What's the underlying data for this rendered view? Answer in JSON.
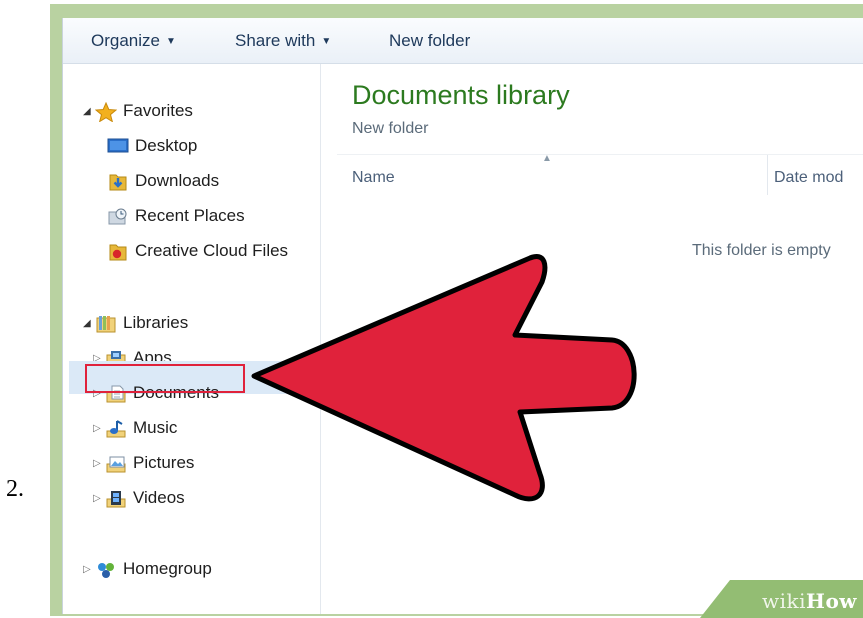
{
  "step": {
    "number": "2."
  },
  "toolbar": {
    "organize": "Organize",
    "share_with": "Share with",
    "new_folder": "New folder"
  },
  "nav": {
    "favorites": {
      "label": "Favorites",
      "items": [
        {
          "label": "Desktop",
          "icon": "desktop-icon"
        },
        {
          "label": "Downloads",
          "icon": "downloads-icon"
        },
        {
          "label": "Recent Places",
          "icon": "recent-places-icon"
        },
        {
          "label": "Creative Cloud Files",
          "icon": "creative-cloud-icon"
        }
      ]
    },
    "libraries": {
      "label": "Libraries",
      "items": [
        {
          "label": "Apps",
          "icon": "apps-library-icon"
        },
        {
          "label": "Documents",
          "icon": "documents-library-icon",
          "selected": true
        },
        {
          "label": "Music",
          "icon": "music-library-icon"
        },
        {
          "label": "Pictures",
          "icon": "pictures-library-icon"
        },
        {
          "label": "Videos",
          "icon": "videos-library-icon"
        }
      ]
    },
    "homegroup": {
      "label": "Homegroup"
    }
  },
  "content": {
    "title": "Documents library",
    "subtitle": "New folder",
    "columns": {
      "name": "Name",
      "date": "Date mod"
    },
    "empty_message": "This folder is empty"
  },
  "watermark": {
    "prefix": "wiki",
    "suffix": "How"
  },
  "colors": {
    "title_green": "#2c7a1f",
    "arrow_red": "#e0223b",
    "frame_green": "#b9d2a1",
    "selection_blue": "#dbe9f7"
  }
}
